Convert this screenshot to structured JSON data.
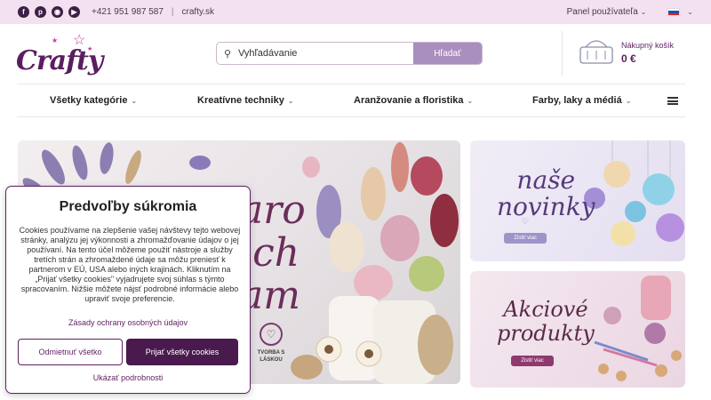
{
  "topbar": {
    "social_icons": [
      "facebook-icon",
      "pinterest-icon",
      "instagram-icon",
      "youtube-icon"
    ],
    "phone": "+421 951 987 587",
    "separator": "|",
    "site": "crafty.sk",
    "user_panel": "Panel používateľa",
    "language": "SK"
  },
  "header": {
    "logo_text": "Crafty",
    "search_placeholder": "Vyhľadávanie",
    "search_button": "Hľadať",
    "cart_label": "Nákupný košík",
    "cart_total": "0 €"
  },
  "nav": {
    "items": [
      {
        "label": "Všetky kategórie"
      },
      {
        "label": "Kreatívne techniky"
      },
      {
        "label": "Aranžovanie a floristika"
      },
      {
        "label": "Farby, laky a médiá"
      }
    ]
  },
  "hero": {
    "script_text": "aro\nich\nam",
    "badge_text": "TVORBA S LÁSKOU"
  },
  "banners": {
    "top": {
      "title": "naše\nnovinky",
      "button": "Zistiť viac"
    },
    "bottom": {
      "title": "Akciové\nprodukty",
      "button": "Zistiť viac"
    }
  },
  "cookie": {
    "title": "Predvoľby súkromia",
    "text": "Cookies používame na zlepšenie vašej návštevy tejto webovej stránky, analýzu jej výkonnosti a zhromažďovanie údajov o jej používaní. Na tento účel môžeme použiť nástroje a služby tretích strán a zhromaždené údaje sa môžu preniesť k partnerom v EÚ, USA alebo iných krajinách. Kliknutím na „Prijať všetky cookies\" vyjadrujete svoj súhlas s týmto spracovaním. Nižšie môžete nájsť podrobné informácie alebo upraviť svoje preferencie.",
    "policy_link": "Zásady ochrany osobných údajov",
    "decline_button": "Odmietnuť všetko",
    "accept_button": "Prijať všetky cookies",
    "details_link": "Ukázať podrobnosti"
  },
  "colors": {
    "brand": "#5a1e60",
    "topbar_bg": "#f3e0f1",
    "accept_bg": "#4a1a4e",
    "search_button_bg": "#a98fbf"
  }
}
